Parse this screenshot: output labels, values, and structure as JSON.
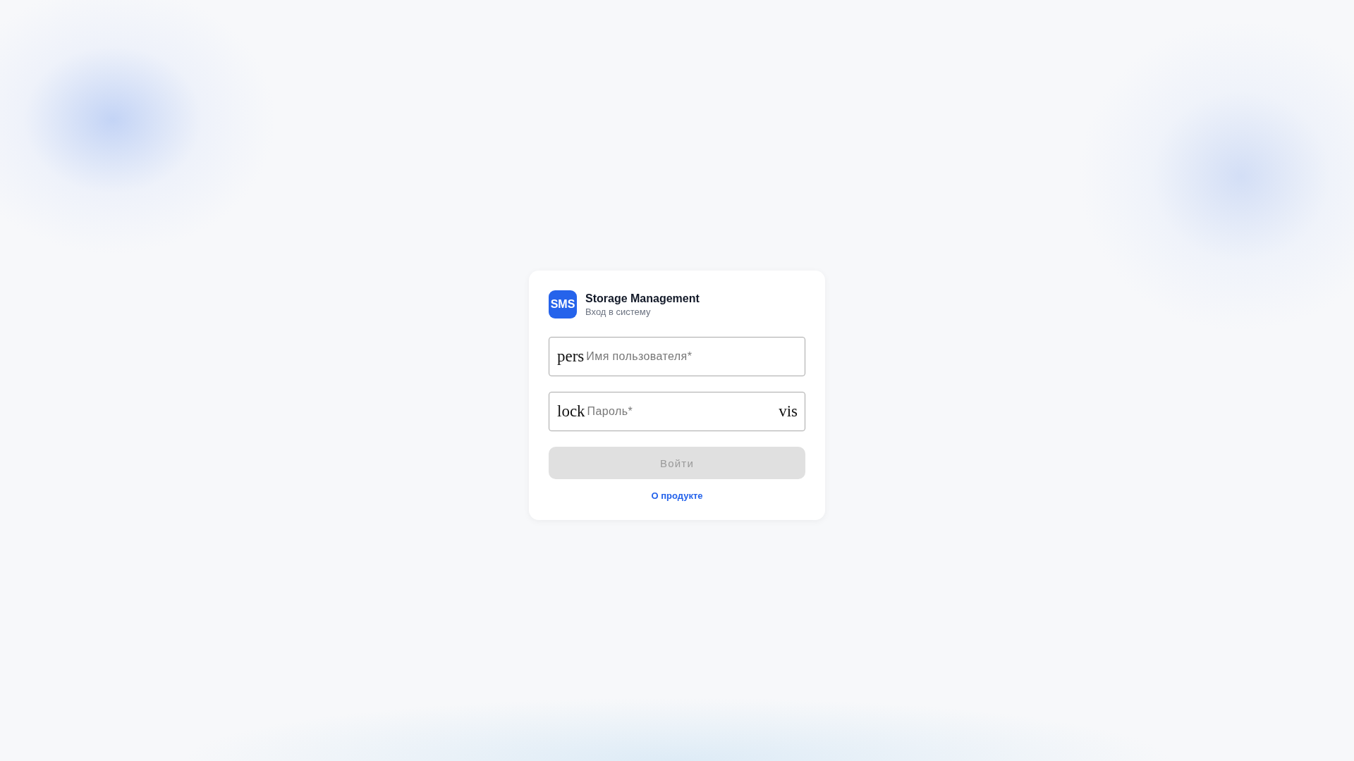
{
  "header": {
    "logo": "SMS",
    "title": "Storage Management",
    "subtitle": "Вход в систему"
  },
  "fields": [
    {
      "icon": "pers",
      "placeholder": "Имя пользователя*"
    },
    {
      "icon": "lock",
      "placeholder": "Пароль*",
      "trailing_icon": "vis"
    }
  ],
  "submit": {
    "label": "Войти",
    "disabled": true
  },
  "link": "О продукте"
}
